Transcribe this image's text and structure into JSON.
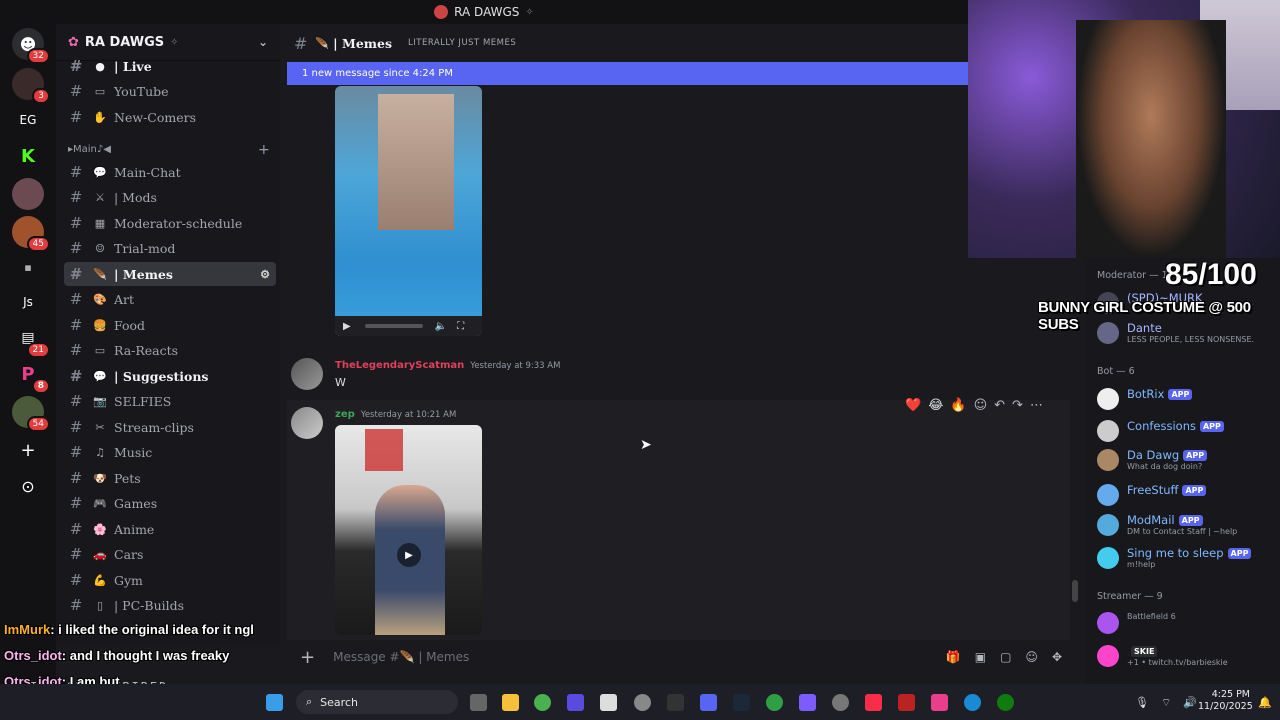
{
  "window": {
    "server_title": "RA DAWGS"
  },
  "rail": {
    "servers": [
      {
        "label": "",
        "badge": "32"
      },
      {
        "label": "",
        "badge": "3"
      },
      {
        "label": "EG",
        "badge": ""
      },
      {
        "label": "K",
        "badge": ""
      },
      {
        "label": "",
        "badge": ""
      },
      {
        "label": "",
        "badge": "45"
      },
      {
        "label": "",
        "badge": ""
      },
      {
        "label": "Js",
        "badge": ""
      },
      {
        "label": "",
        "badge": "21"
      },
      {
        "label": "P",
        "badge": "8"
      },
      {
        "label": "",
        "badge": "54"
      }
    ],
    "add_label": "+",
    "discover_label": "⊙"
  },
  "sidebar": {
    "server_name": "RA DAWGS",
    "category": "▸Main♪◀",
    "channels": [
      {
        "name": "| Live",
        "emoji": "●",
        "state": "unread"
      },
      {
        "name": "YouTube",
        "emoji": "▭",
        "state": ""
      },
      {
        "name": "New-Comers",
        "emoji": "✋",
        "state": ""
      },
      {
        "name": "Main-Chat",
        "emoji": "💬",
        "state": ""
      },
      {
        "name": "| Mods",
        "emoji": "⚔",
        "state": ""
      },
      {
        "name": "Moderator-schedule",
        "emoji": "▦",
        "state": ""
      },
      {
        "name": "Trial-mod",
        "emoji": "☺",
        "state": ""
      },
      {
        "name": "| Memes",
        "emoji": "🪶",
        "state": "active"
      },
      {
        "name": "Art",
        "emoji": "🎨",
        "state": ""
      },
      {
        "name": "Food",
        "emoji": "🍔",
        "state": ""
      },
      {
        "name": "Ra-Reacts",
        "emoji": "▭",
        "state": ""
      },
      {
        "name": "| Suggestions",
        "emoji": "💬",
        "state": "unread"
      },
      {
        "name": "SELFIES",
        "emoji": "📷",
        "state": ""
      },
      {
        "name": "Stream-clips",
        "emoji": "✂",
        "state": ""
      },
      {
        "name": "Music",
        "emoji": "♫",
        "state": ""
      },
      {
        "name": "Pets",
        "emoji": "🐶",
        "state": ""
      },
      {
        "name": "Games",
        "emoji": "🎮",
        "state": ""
      },
      {
        "name": "Anime",
        "emoji": "🌸",
        "state": ""
      },
      {
        "name": "Cars",
        "emoji": "🚗",
        "state": ""
      },
      {
        "name": "Gym",
        "emoji": "💪",
        "state": ""
      },
      {
        "name": "| PC-Builds",
        "emoji": "▯",
        "state": ""
      }
    ]
  },
  "chat": {
    "channel_title": "| Memes",
    "topic": "LITERALLY JUST MEMES",
    "new_messages": "1 new message since 4:24 PM",
    "messages": [
      {
        "author": "TheLegendaryScatman",
        "time": "Yesterday at 9:33 AM",
        "text": "W"
      },
      {
        "author": "zep",
        "time": "Yesterday at 10:21 AM",
        "text": ""
      }
    ],
    "composer_placeholder": "Message #🪶 | Memes",
    "reactions": [
      "❤️",
      "😂",
      "🔥"
    ]
  },
  "members": {
    "groups": [
      {
        "title": "Moderator — 1"
      },
      {
        "title": "Bot — 6"
      },
      {
        "title": "Streamer — 9"
      }
    ],
    "list": [
      {
        "name": "(SPD)~MURK",
        "sub": "",
        "app": false
      },
      {
        "name": "Dante",
        "sub": "LESS PEOPLE, LESS NONSENSE.",
        "app": false
      },
      {
        "name": "BotRix",
        "sub": "",
        "app": true
      },
      {
        "name": "Confessions",
        "sub": "",
        "app": true
      },
      {
        "name": "Da Dawg",
        "sub": "What da dog doin?",
        "app": true
      },
      {
        "name": "FreeStuff",
        "sub": "",
        "app": true
      },
      {
        "name": "ModMail",
        "sub": "DM to Contact Staff | ~help",
        "app": true
      },
      {
        "name": "Sing me to sleep",
        "sub": "m!help",
        "app": true
      },
      {
        "name": "",
        "sub": "Battlefield 6",
        "app": false
      },
      {
        "name": "",
        "sub": "+1 • twitch.tv/barbieskie",
        "app": false
      }
    ],
    "app_label": "APP",
    "skie_tag": "SKIE"
  },
  "overlay": {
    "goal_count": "85/100",
    "goal_text": "BUNNY GIRL COSTUME @ 500 SUBS",
    "chat_lines": [
      {
        "user": "ImMurk",
        "msg": ": i liked the original idea for it ngl"
      },
      {
        "user": "Otrs_idot",
        "msg": ": and I thought I was freaky"
      },
      {
        "user": "Otrs_idot",
        "msg": ": I am but"
      },
      {
        "user": "Otrs_idot",
        "msg": ":"
      }
    ],
    "ghost_text": "INTLOWN EXPIRED"
  },
  "taskbar": {
    "search_label": "Search",
    "time": "4:25 PM",
    "date": "11/20/2025"
  },
  "colors": {
    "accent": "#5865f2",
    "mod_name": "#e0405a",
    "user_zep": "#3ba55c",
    "twitch_user": "#ffb3f0"
  }
}
